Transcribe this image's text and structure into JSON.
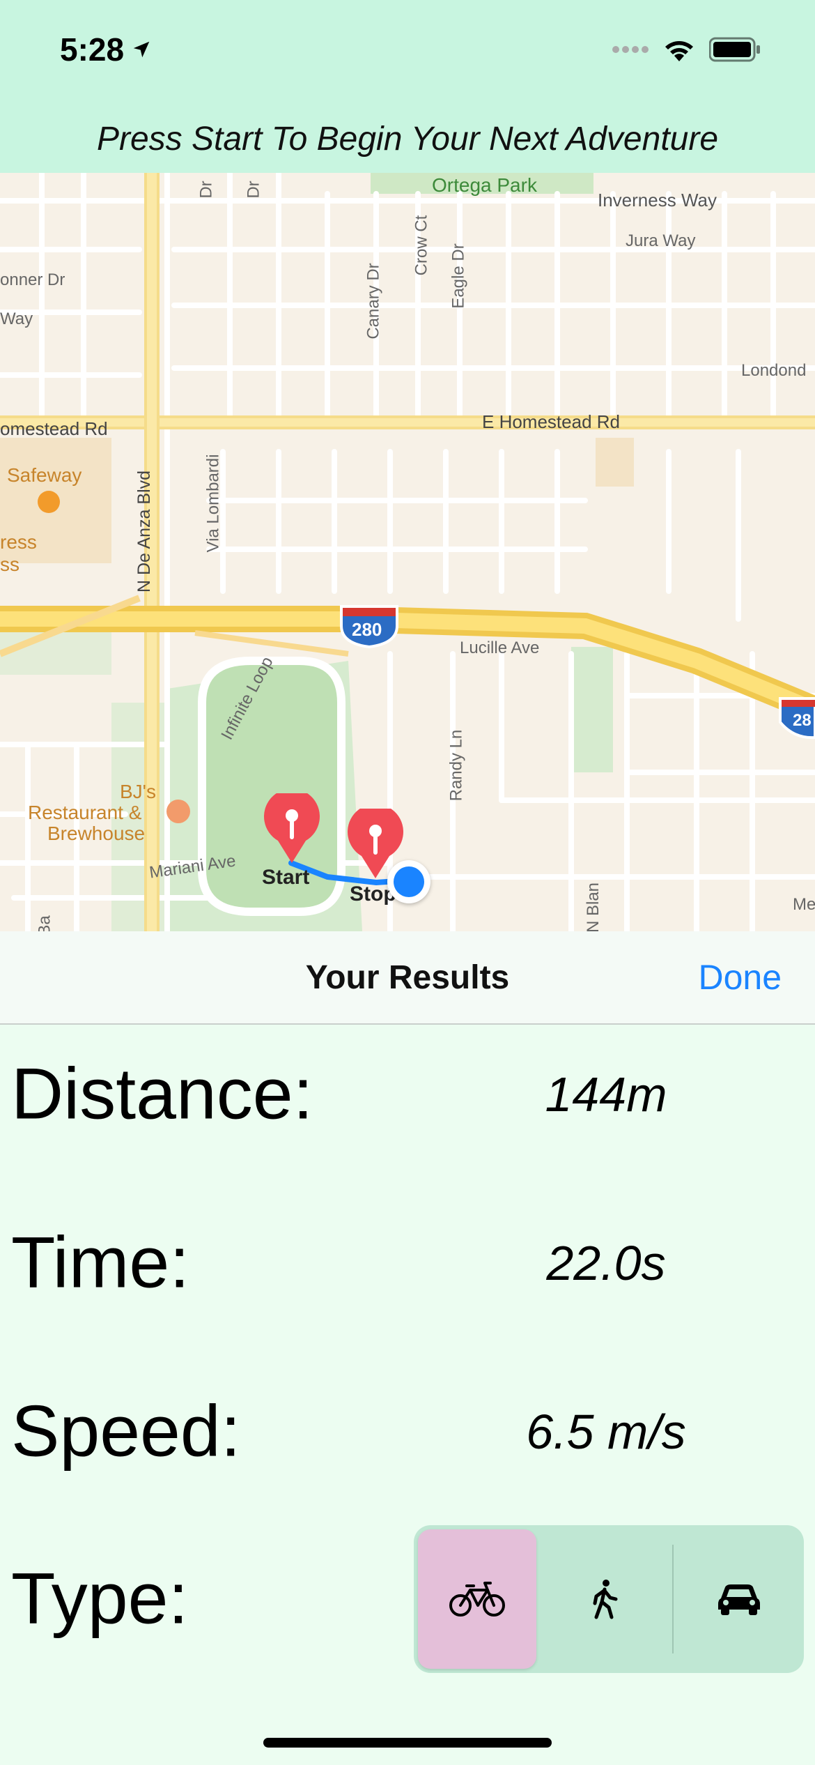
{
  "status_bar": {
    "time": "5:28"
  },
  "header": {
    "title": "Press Start To Begin Your Next Adventure"
  },
  "map": {
    "labels": {
      "ortega_park": "Ortega Park",
      "inverness_way": "Inverness Way",
      "jura_way": "Jura Way",
      "londond": "Londond",
      "onner_dr": "onner Dr",
      "way": "Way",
      "canary_dr": "Canary Dr",
      "crow_ct": "Crow Ct",
      "eagle_dr": "Eagle Dr",
      "dr1": "Dr",
      "dr2": "Dr",
      "homestead_left": "omestead Rd",
      "homestead_right": "E Homestead Rd",
      "safeway": "Safeway",
      "ress": "ress",
      "ss": "ss",
      "de_anza": "N De Anza Blvd",
      "via_lombardi": "Via Lombardi",
      "i280": "280",
      "i280_right": "28",
      "lucille_ave": "Lucille Ave",
      "infinite_loop": "Infinite Loop",
      "randy_ln": "Randy Ln",
      "bjs_1": "BJ's",
      "bjs_2": "Restaurant &",
      "bjs_3": "Brewhouse",
      "mariani_ave": "Mariani Ave",
      "n_blan": "N Blan",
      "me": "Me",
      "ba": "Ba"
    },
    "pins": {
      "start_label": "Start",
      "stop_label": "Stop"
    }
  },
  "sheet": {
    "title": "Your Results",
    "done_label": "Done"
  },
  "results": {
    "distance_label": "Distance:",
    "distance_value": "144m",
    "time_label": "Time:",
    "time_value": "22.0s",
    "speed_label": "Speed:",
    "speed_value": "6.5 m/s",
    "type_label": "Type:"
  },
  "type_selector": {
    "options": [
      "bicycle-icon",
      "walking-icon",
      "car-icon"
    ],
    "selected": 0
  },
  "colors": {
    "header_bg": "#c8f5e0",
    "results_bg": "#ecfdf1",
    "accent": "#1a84ff",
    "pin": "#f04a54",
    "selected_segment": "#e4bfd9",
    "segment_bg": "#bfe7d3"
  }
}
